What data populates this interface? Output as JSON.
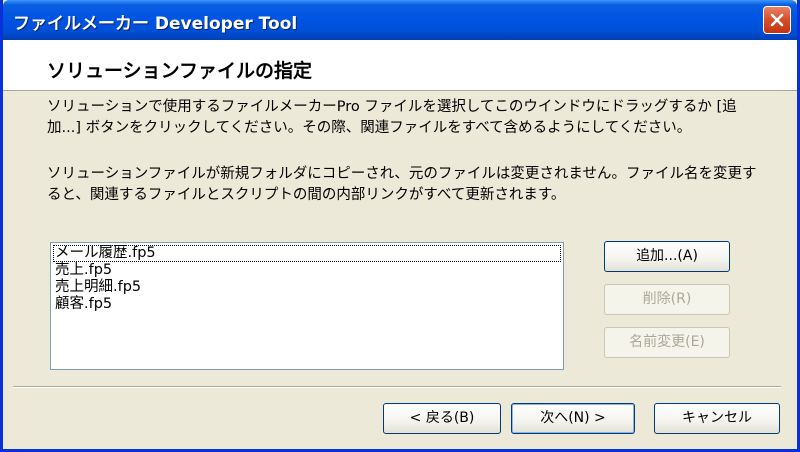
{
  "window": {
    "title": "ファイルメーカー Developer Tool"
  },
  "header": {
    "title": "ソリューションファイルの指定"
  },
  "body": {
    "description_1": "ソリューションで使用するファイルメーカーPro ファイルを選択してこのウインドウにドラッグするか [追加...] ボタンをクリックしてください。その際、関連ファイルをすべて含めるようにしてください。",
    "description_2": "ソリューションファイルが新規フォルダにコピーされ、元のファイルは変更されません。ファイル名を変更すると、関連するファイルとスクリプトの間の内部リンクがすべて更新されます。"
  },
  "file_list": {
    "items": [
      {
        "label": "メール履歴.fp5"
      },
      {
        "label": "売上.fp5"
      },
      {
        "label": "売上明細.fp5"
      },
      {
        "label": "顧客.fp5"
      }
    ]
  },
  "side_buttons": {
    "add": "追加...(A)",
    "delete": "削除(R)",
    "rename": "名前変更(E)"
  },
  "footer_buttons": {
    "back": "< 戻る(B)",
    "next": "次へ(N) >",
    "cancel": "キャンセル"
  },
  "colors": {
    "titlebar": "#0054e3",
    "dialog_bg": "#ece9d8",
    "close_button": "#d9502e"
  }
}
